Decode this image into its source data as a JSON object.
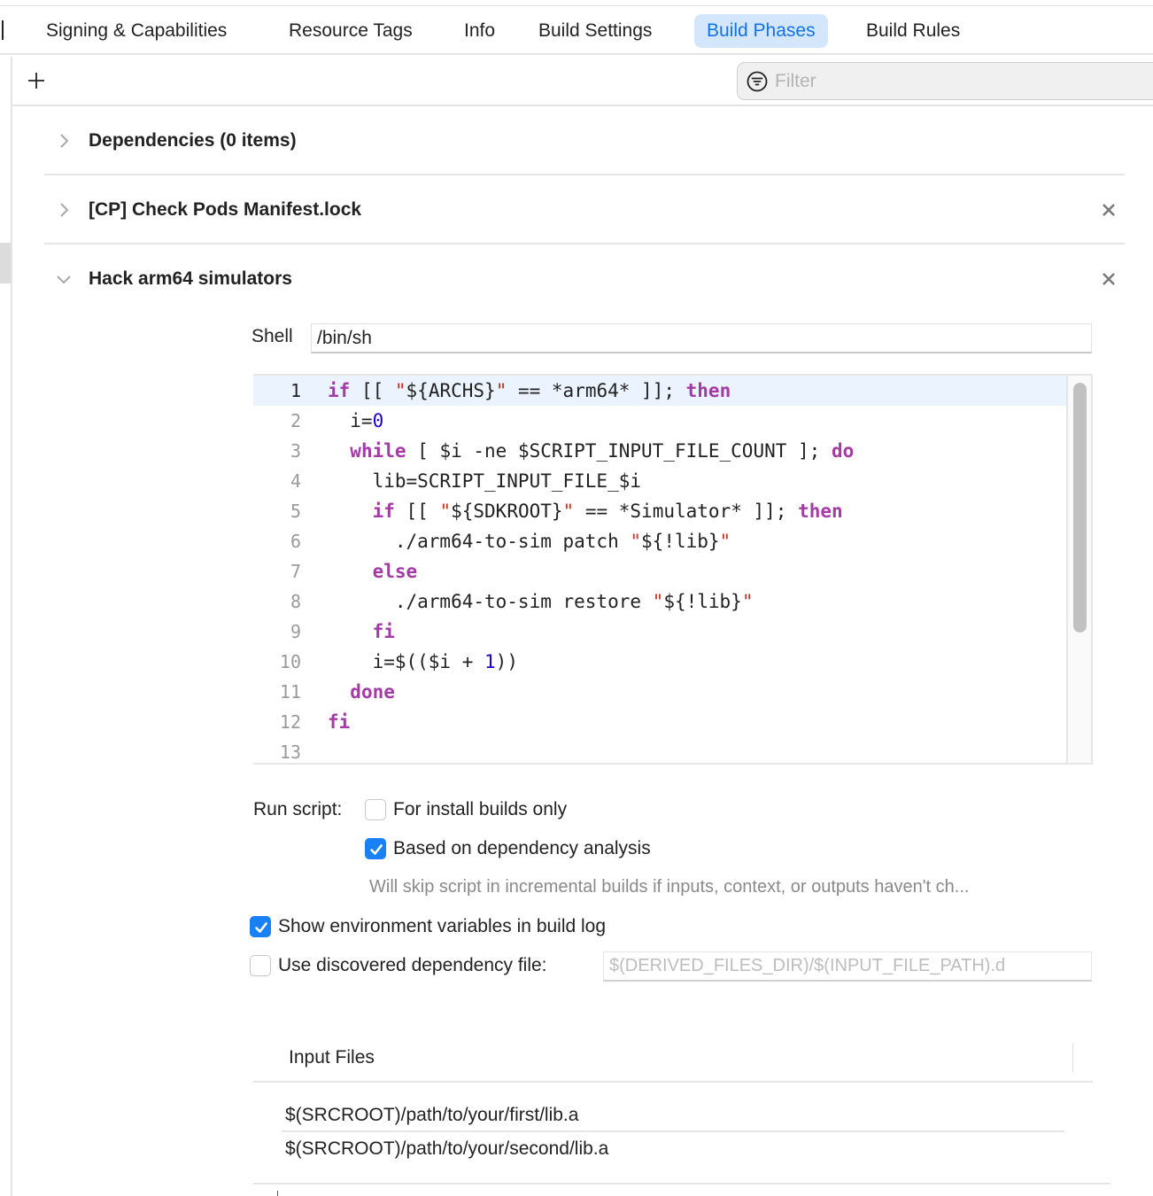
{
  "tabs": [
    {
      "label": "Signing & Capabilities",
      "active": false
    },
    {
      "label": "Resource Tags",
      "active": false
    },
    {
      "label": "Info",
      "active": false
    },
    {
      "label": "Build Settings",
      "active": false
    },
    {
      "label": "Build Phases",
      "active": true
    },
    {
      "label": "Build Rules",
      "active": false
    }
  ],
  "toolbar": {
    "add_icon": "plus-icon",
    "filter_placeholder": "Filter",
    "filter_value": "",
    "filter_icon": "filter-circle-icon"
  },
  "phases": [
    {
      "title": "Dependencies (0 items)",
      "expanded": false,
      "removable": false
    },
    {
      "title": "[CP] Check Pods Manifest.lock",
      "expanded": false,
      "removable": true
    },
    {
      "title": "Hack arm64 simulators",
      "expanded": true,
      "removable": true
    }
  ],
  "script_phase": {
    "shell_label": "Shell",
    "shell_value": "/bin/sh",
    "current_line": 1,
    "code_lines": [
      {
        "n": "1",
        "tokens": [
          [
            "kw",
            "if"
          ],
          [
            "t",
            " [[ "
          ],
          [
            "str",
            "\""
          ],
          [
            "t",
            "${ARCHS}"
          ],
          [
            "str",
            "\""
          ],
          [
            "t",
            " == *arm64* ]]; "
          ],
          [
            "kw",
            "then"
          ]
        ]
      },
      {
        "n": "2",
        "tokens": [
          [
            "t",
            "  i="
          ],
          [
            "num",
            "0"
          ]
        ]
      },
      {
        "n": "3",
        "tokens": [
          [
            "t",
            "  "
          ],
          [
            "kw",
            "while"
          ],
          [
            "t",
            " [ $i -ne $SCRIPT_INPUT_FILE_COUNT ]; "
          ],
          [
            "kw",
            "do"
          ]
        ]
      },
      {
        "n": "4",
        "tokens": [
          [
            "t",
            "    lib=SCRIPT_INPUT_FILE_$i"
          ]
        ]
      },
      {
        "n": "5",
        "tokens": [
          [
            "t",
            "    "
          ],
          [
            "kw",
            "if"
          ],
          [
            "t",
            " [[ "
          ],
          [
            "str",
            "\""
          ],
          [
            "t",
            "${SDKROOT}"
          ],
          [
            "str",
            "\""
          ],
          [
            "t",
            " == *Simulator* ]]; "
          ],
          [
            "kw",
            "then"
          ]
        ]
      },
      {
        "n": "6",
        "tokens": [
          [
            "t",
            "      ./arm64-to-sim patch "
          ],
          [
            "str",
            "\""
          ],
          [
            "t",
            "${!lib}"
          ],
          [
            "str",
            "\""
          ]
        ]
      },
      {
        "n": "7",
        "tokens": [
          [
            "t",
            "    "
          ],
          [
            "kw",
            "else"
          ]
        ]
      },
      {
        "n": "8",
        "tokens": [
          [
            "t",
            "      ./arm64-to-sim restore "
          ],
          [
            "str",
            "\""
          ],
          [
            "t",
            "${!lib}"
          ],
          [
            "str",
            "\""
          ]
        ]
      },
      {
        "n": "9",
        "tokens": [
          [
            "t",
            "    "
          ],
          [
            "kw",
            "fi"
          ]
        ]
      },
      {
        "n": "10",
        "tokens": [
          [
            "t",
            "    i=$(($i + "
          ],
          [
            "num",
            "1"
          ],
          [
            "t",
            "))"
          ]
        ]
      },
      {
        "n": "11",
        "tokens": [
          [
            "t",
            "  "
          ],
          [
            "kw",
            "done"
          ]
        ]
      },
      {
        "n": "12",
        "tokens": [
          [
            "kw",
            "fi"
          ]
        ]
      },
      {
        "n": "13",
        "tokens": []
      }
    ],
    "scroll_position": 0.0,
    "run_script_label": "Run script:",
    "install_builds_only": {
      "label": "For install builds only",
      "checked": false
    },
    "dependency_analysis": {
      "label": "Based on dependency analysis",
      "checked": true
    },
    "dependency_hint": "Will skip script in incremental builds if inputs, context, or outputs haven't ch...",
    "show_env_vars": {
      "label": "Show environment variables in build log",
      "checked": true
    },
    "use_dep_file": {
      "label": "Use discovered dependency file:",
      "checked": false
    },
    "dep_file_placeholder": "$(DERIVED_FILES_DIR)/$(INPUT_FILE_PATH).d",
    "dep_file_value": ""
  },
  "input_files": {
    "header": "Input Files",
    "rows": [
      "$(SRCROOT)/path/to/your/first/lib.a",
      "$(SRCROOT)/path/to/your/second/lib.a"
    ]
  },
  "colors": {
    "accent": "#1a80f5",
    "active_tab_bg": "#d3e6fc",
    "active_tab_text": "#1272e8",
    "keyword": "#a43aa5",
    "string": "#d12f1b",
    "number": "#1c00cf",
    "current_line_bg": "#ebf3fe"
  }
}
